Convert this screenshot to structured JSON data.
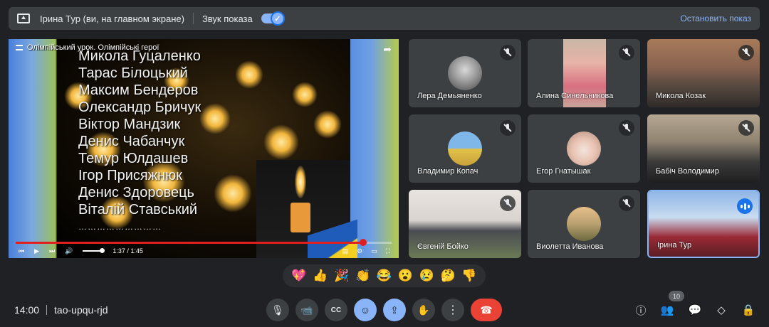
{
  "topbar": {
    "presenter": "Ірина Тур (ви, на главном экране)",
    "sound_label": "Звук показа",
    "sound_on": true,
    "stop_label": "Остановить показ"
  },
  "presentation": {
    "title": "Олімпійський урок. Олімпійські герої",
    "names": [
      "Микола Гуцаленко",
      "Тарас Білоцький",
      "Максим Бендеров",
      "Олександр Бричук",
      "Віктор Мандзик",
      "Денис Чабанчук",
      "Темур Юлдашев",
      "Ігор Присяжнюк",
      "Денис Здоровець",
      "Віталій Ставський"
    ],
    "dots": "………………………",
    "time": "1:37 / 1:45",
    "progress_fraction": 0.924,
    "volume_fraction": 0.9
  },
  "participants": [
    {
      "name": "Лера Демьяненко",
      "muted": true
    },
    {
      "name": "Алина Синельникова",
      "muted": true
    },
    {
      "name": "Микола Козак",
      "muted": true
    },
    {
      "name": "Владимир Копач",
      "muted": true
    },
    {
      "name": "Егор Гнатышак",
      "muted": true
    },
    {
      "name": "Бабіч Володимир",
      "muted": true
    },
    {
      "name": "Євгеній Бойко",
      "muted": true
    },
    {
      "name": "Виолетта Иванова",
      "muted": true
    },
    {
      "name": "Ірина Тур",
      "muted": false,
      "speaking": true
    }
  ],
  "reactions": [
    "💖",
    "👍",
    "🎉",
    "👏",
    "😂",
    "😮",
    "😢",
    "🤔",
    "👎"
  ],
  "bottombar": {
    "time": "14:00",
    "meeting_code": "tao-upqu-rjd",
    "participant_count": "10"
  },
  "colors": {
    "background": "#202124",
    "surface": "#3c4043",
    "accent": "#8ab4f8",
    "end_call": "#ea4335",
    "speaking": "#1a73e8"
  }
}
